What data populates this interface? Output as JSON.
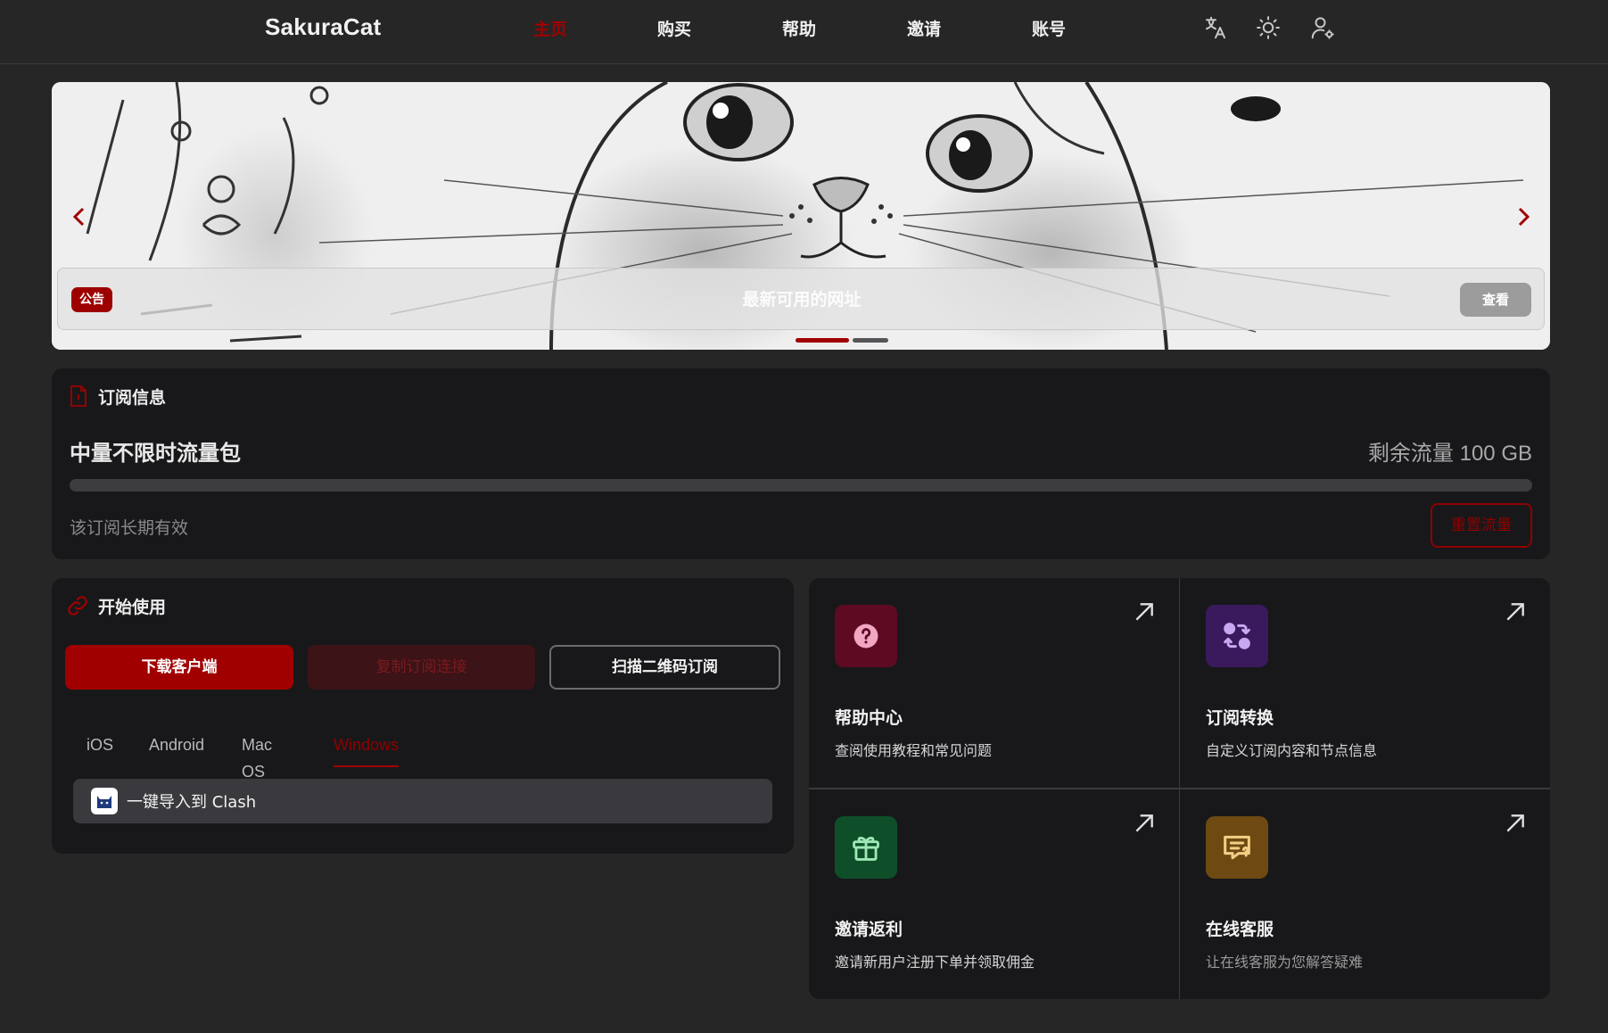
{
  "app": {
    "brand": "SakuraCat"
  },
  "nav": {
    "items": [
      {
        "label": "主页",
        "active": true
      },
      {
        "label": "购买",
        "active": false
      },
      {
        "label": "帮助",
        "active": false
      },
      {
        "label": "邀请",
        "active": false
      },
      {
        "label": "账号",
        "active": false
      }
    ],
    "icons": [
      "translate-icon",
      "theme-sun-icon",
      "user-settings-icon"
    ]
  },
  "banner": {
    "notice_badge": "公告",
    "notice_title": "最新可用的网址",
    "view_button": "查看",
    "slides_total": 2,
    "slide_active": 1
  },
  "subscription": {
    "header": "订阅信息",
    "plan_name": "中量不限时流量包",
    "remaining": "剩余流量 100 GB",
    "usage_fraction": 0,
    "validity": "该订阅长期有效",
    "reset_button": "重置流量"
  },
  "start": {
    "header": "开始使用",
    "download_button": "下载客户端",
    "copy_button": "复制订阅连接",
    "scan_button": "扫描二维码订阅",
    "tabs": [
      {
        "label": "iOS",
        "active": false
      },
      {
        "label": "Android",
        "active": false
      },
      {
        "label": "Mac OS",
        "active": false
      },
      {
        "label": "Windows",
        "active": true
      }
    ],
    "import_label": "一键导入到 Clash"
  },
  "quick": [
    {
      "title": "帮助中心",
      "desc": "查阅使用教程和常见问题",
      "icon": "help-question-icon",
      "color": "#5e0a22",
      "glyph": "#f1a6c2"
    },
    {
      "title": "订阅转换",
      "desc": "自定义订阅内容和节点信息",
      "icon": "convert-icon",
      "color": "#3a1a5c",
      "glyph": "#c9a8f2"
    },
    {
      "title": "邀请返利",
      "desc": "邀请新用户注册下单并领取佣金",
      "icon": "gift-icon",
      "color": "#0e4f2a",
      "glyph": "#9ee8b6"
    },
    {
      "title": "在线客服",
      "desc": "让在线客服为您解答疑难",
      "icon": "chat-support-icon",
      "color": "#6e4a12",
      "glyph": "#f2cf86"
    }
  ],
  "colors": {
    "accent": "#a10000",
    "background": "#262626",
    "card": "#18181b"
  }
}
